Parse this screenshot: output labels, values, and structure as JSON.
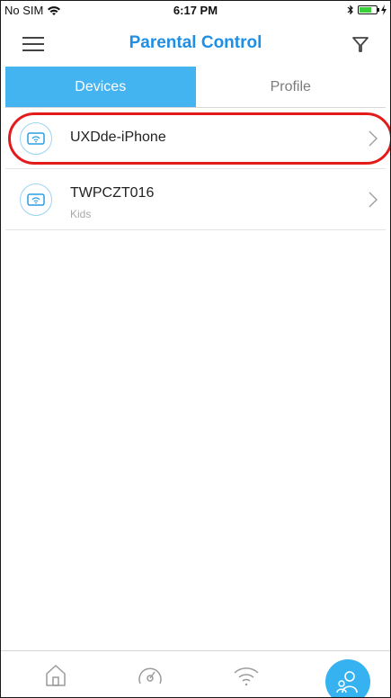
{
  "status_bar": {
    "carrier": "No SIM",
    "time": "6:17 PM",
    "battery_level": 0.7
  },
  "header": {
    "title": "Parental Control"
  },
  "tabs": [
    {
      "label": "Devices",
      "active": true
    },
    {
      "label": "Profile",
      "active": false
    }
  ],
  "devices": [
    {
      "name": "UXDde-iPhone",
      "profile": ""
    },
    {
      "name": "TWPCZT016",
      "profile": "Kids"
    }
  ],
  "colors": {
    "accent": "#1f8fe6",
    "tab_active": "#43b4f0",
    "highlight": "#e41b1b"
  },
  "bottom_nav": [
    {
      "icon": "home-icon",
      "active": false
    },
    {
      "icon": "speedometer-icon",
      "active": false
    },
    {
      "icon": "wifi-icon",
      "active": false
    },
    {
      "icon": "parental-control-icon",
      "active": true
    }
  ]
}
